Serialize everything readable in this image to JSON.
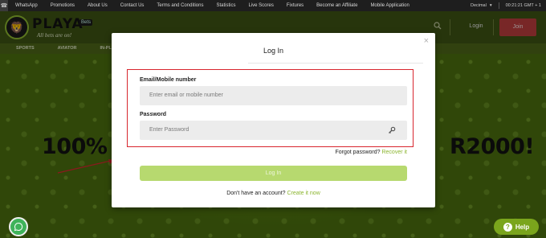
{
  "topbar": {
    "links": [
      "WhatsApp",
      "Promotions",
      "About Us",
      "Contact Us",
      "Terms and Conditions",
      "Statistics",
      "Live Scores",
      "Fixtures",
      "Become an Affiliate",
      "Mobile Application"
    ],
    "odds_format": "Decimal",
    "time": "00:21:21 GMT + 1"
  },
  "header": {
    "brand": "PLAYA",
    "brand_badge": "Bets",
    "tagline": "All bets are on!",
    "login_label": "Login",
    "join_label": "Join"
  },
  "nav": {
    "items": [
      "SPORTS",
      "AVIATOR",
      "IN-PLAY"
    ]
  },
  "hero": {
    "promo_left": "100% ",
    "promo_right": "R2000!"
  },
  "modal": {
    "title": "Log In",
    "email_label": "Email/Mobile number",
    "email_placeholder": "Enter email or mobile number",
    "password_label": "Password",
    "password_placeholder": "Enter Password",
    "forgot_text": "Forgot password?",
    "forgot_link": "Recover it",
    "login_button": "Log In",
    "signup_text": "Don't have an account?",
    "signup_link": "Create it now"
  },
  "widgets": {
    "help_label": "Help"
  },
  "colors": {
    "accent": "#8bb52f",
    "join": "#b83c3c",
    "highlight_border": "#d8262e",
    "login_button": "#b7d96f"
  },
  "icons": [
    "phone-icon",
    "search-icon",
    "close-icon",
    "key-icon",
    "chat-icon",
    "help-icon"
  ]
}
